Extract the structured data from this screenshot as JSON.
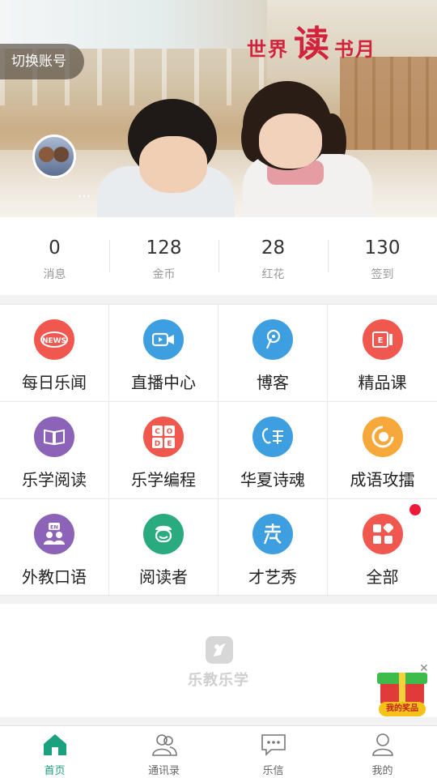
{
  "banner": {
    "title_left": "世界",
    "title_big": "读",
    "title_right": "书月",
    "switch_account": "切换账号",
    "username": "..."
  },
  "stats": [
    {
      "value": "0",
      "label": "消息"
    },
    {
      "value": "128",
      "label": "金币"
    },
    {
      "value": "28",
      "label": "红花"
    },
    {
      "value": "130",
      "label": "签到"
    }
  ],
  "grid": [
    {
      "label": "每日乐闻",
      "icon": "news-icon",
      "color": "#f0584f"
    },
    {
      "label": "直播中心",
      "icon": "video-camera-icon",
      "color": "#3e9fe0"
    },
    {
      "label": "博客",
      "icon": "blog-pen-icon",
      "color": "#3e9fe0"
    },
    {
      "label": "精品课",
      "icon": "courseware-icon",
      "color": "#f0584f"
    },
    {
      "label": "乐学阅读",
      "icon": "book-icon",
      "color": "#8b63b8"
    },
    {
      "label": "乐学编程",
      "icon": "code-blocks-icon",
      "color": "#f0584f"
    },
    {
      "label": "华夏诗魂",
      "icon": "poem-icon",
      "color": "#3e9fe0"
    },
    {
      "label": "成语攻擂",
      "icon": "idiom-icon",
      "color": "#f6a83a"
    },
    {
      "label": "外教口语",
      "icon": "english-speaker-icon",
      "color": "#8b63b8"
    },
    {
      "label": "阅读者",
      "icon": "reader-face-icon",
      "color": "#2aaa7f"
    },
    {
      "label": "才艺秀",
      "icon": "talent-show-icon",
      "color": "#3e9fe0"
    },
    {
      "label": "全部",
      "icon": "all-apps-icon",
      "color": "#f0584f"
    }
  ],
  "brand": {
    "name": "乐教乐学"
  },
  "gift": {
    "label": "我的奖品"
  },
  "tabs": [
    {
      "label": "首页",
      "icon": "home-icon",
      "active": true
    },
    {
      "label": "通讯录",
      "icon": "contacts-icon",
      "active": false
    },
    {
      "label": "乐信",
      "icon": "chat-icon",
      "active": false
    },
    {
      "label": "我的",
      "icon": "profile-icon",
      "active": false
    }
  ],
  "colors": {
    "accent": "#1aa17d",
    "title_red": "#d2233c",
    "badge_red": "#ee1a3a"
  }
}
